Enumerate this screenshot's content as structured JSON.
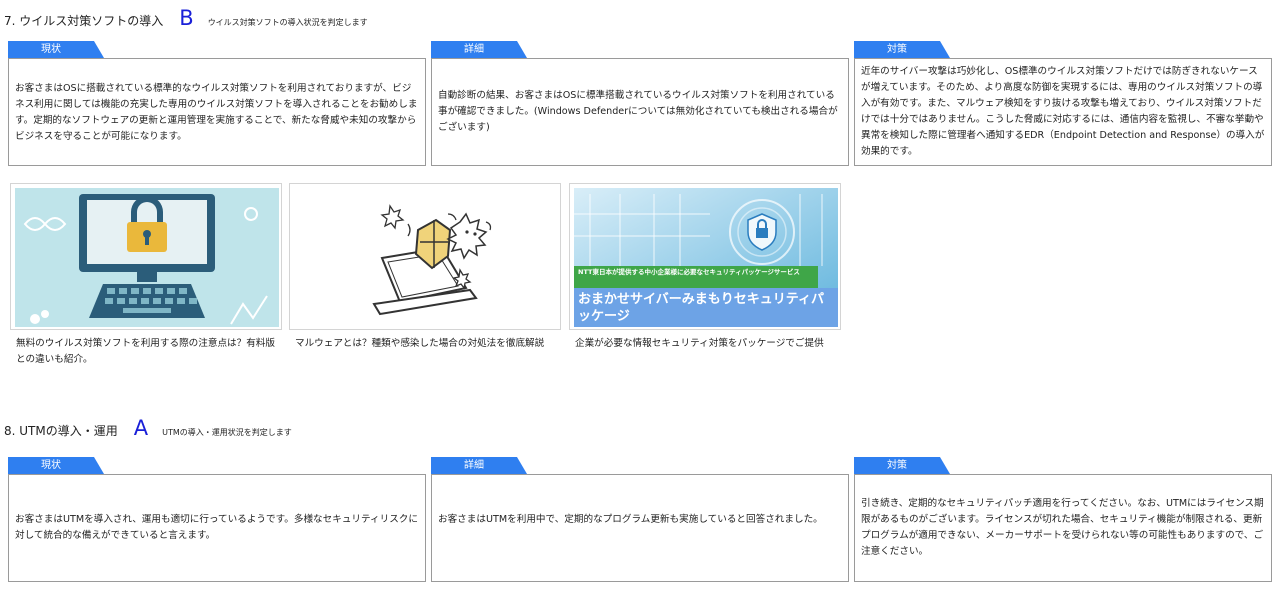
{
  "section7": {
    "title": "7. ウイルス対策ソフトの導入",
    "grade": "B",
    "description": "ウイルス対策ソフトの導入状況を判定します",
    "cards": [
      {
        "tab": "現状",
        "text": "お客さまはOSに搭載されている標準的なウイルス対策ソフトを利用されておりますが、ビジネス利用に関しては機能の充実した専用のウイルス対策ソフトを導入されることをお勧めします。定期的なソフトウェアの更新と運用管理を実施することで、新たな脅威や未知の攻撃からビジネスを守ることが可能になります。"
      },
      {
        "tab": "詳細",
        "text": "自動診断の結果、お客さまはOSに標準搭載されているウイルス対策ソフトを利用されている事が確認できました。(Windows Defenderについては無効化されていても検出される場合がございます)"
      },
      {
        "tab": "対策",
        "text": "近年のサイバー攻撃は巧妙化し、OS標準のウイルス対策ソフトだけでは防ぎきれないケースが増えています。そのため、より高度な防御を実現するには、専用のウイルス対策ソフトの導入が有効です。また、マルウェア検知をすり抜ける攻撃も増えており、ウイルス対策ソフトだけでは十分ではありません。こうした脅威に対応するには、通信内容を監視し、不審な挙動や異常を検知した際に管理者へ通知するEDR（Endpoint Detection and Response）の導入が効果的です。"
      }
    ],
    "articles": [
      {
        "caption": "無料のウイルス対策ソフトを利用する際の注意点は？有料版との違いも紹介。"
      },
      {
        "caption": "マルウェアとは？種類や感染した場合の対処法を徹底解説"
      },
      {
        "caption": "企業が必要な情報セキュリティ対策をパッケージでご提供",
        "banner_small": "NTT東日本が提供する中小企業様に必要なセキュリティパッケージサービス",
        "banner_large": "おまかせサイバーみまもりセキュリティパッケージ"
      }
    ]
  },
  "section8": {
    "title": "8. UTMの導入・運用",
    "grade": "A",
    "description": "UTMの導入・運用状況を判定します",
    "cards": [
      {
        "tab": "現状",
        "text": "お客さまはUTMを導入され、運用も適切に行っているようです。多様なセキュリティリスクに対して統合的な備えができていると言えます。"
      },
      {
        "tab": "詳細",
        "text": "お客さまはUTMを利用中で、定期的なプログラム更新も実施していると回答されました。"
      },
      {
        "tab": "対策",
        "text": "引き続き、定期的なセキュリティパッチ適用を行ってください。なお、UTMにはライセンス期限があるものがございます。ライセンスが切れた場合、セキュリティ機能が制限される、更新プログラムが適用できない、メーカーサポートを受けられない等の可能性もありますので、ご注意ください。"
      }
    ]
  },
  "colors": {
    "tab": "#2f7ff0",
    "grade": "#1a20d8",
    "border": "#9a9a9a"
  }
}
